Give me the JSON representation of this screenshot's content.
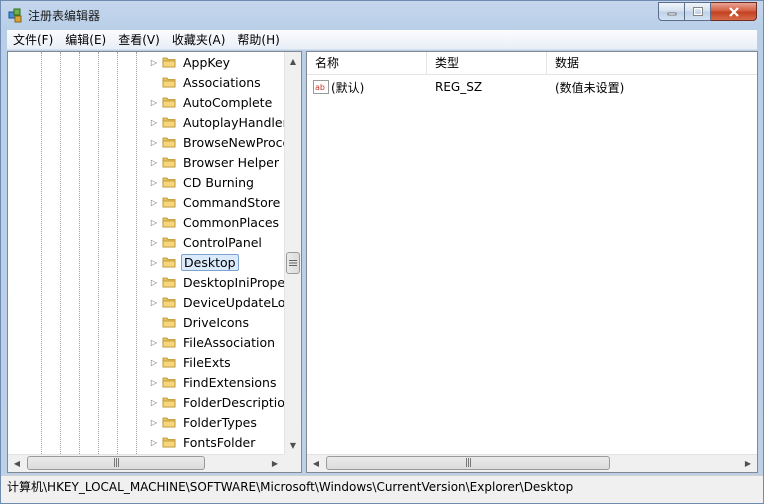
{
  "window": {
    "title": "注册表编辑器"
  },
  "menu": [
    {
      "label": "文件(F)"
    },
    {
      "label": "编辑(E)"
    },
    {
      "label": "查看(V)"
    },
    {
      "label": "收藏夹(A)"
    },
    {
      "label": "帮助(H)"
    }
  ],
  "tree": {
    "items": [
      {
        "label": "AppKey",
        "expandable": true
      },
      {
        "label": "Associations",
        "expandable": false
      },
      {
        "label": "AutoComplete",
        "expandable": true
      },
      {
        "label": "AutoplayHandlers",
        "expandable": true
      },
      {
        "label": "BrowseNewProce",
        "expandable": true
      },
      {
        "label": "Browser Helper (",
        "expandable": true
      },
      {
        "label": "CD Burning",
        "expandable": true
      },
      {
        "label": "CommandStore",
        "expandable": true
      },
      {
        "label": "CommonPlaces",
        "expandable": true
      },
      {
        "label": "ControlPanel",
        "expandable": true
      },
      {
        "label": "Desktop",
        "expandable": true,
        "selected": true
      },
      {
        "label": "DesktopIniPrope",
        "expandable": true
      },
      {
        "label": "DeviceUpdateLoc",
        "expandable": true
      },
      {
        "label": "DriveIcons",
        "expandable": false
      },
      {
        "label": "FileAssociation",
        "expandable": true
      },
      {
        "label": "FileExts",
        "expandable": true
      },
      {
        "label": "FindExtensions",
        "expandable": true
      },
      {
        "label": "FolderDescriptio",
        "expandable": true
      },
      {
        "label": "FolderTypes",
        "expandable": true
      },
      {
        "label": "FontsFolder",
        "expandable": true
      }
    ]
  },
  "values_list": {
    "columns": [
      {
        "label": "名称"
      },
      {
        "label": "类型"
      },
      {
        "label": "数据"
      }
    ],
    "rows": [
      {
        "name": "(默认)",
        "type": "REG_SZ",
        "data": "(数值未设置)",
        "icon": "ab-string-value-icon"
      }
    ]
  },
  "statusbar": {
    "path": "计算机\\HKEY_LOCAL_MACHINE\\SOFTWARE\\Microsoft\\Windows\\CurrentVersion\\Explorer\\Desktop"
  },
  "colors": {
    "folder": "#e8c35a",
    "selection_bg": "#dcebfc",
    "selection_border": "#7da2ce",
    "close_button": "#c3401f"
  }
}
